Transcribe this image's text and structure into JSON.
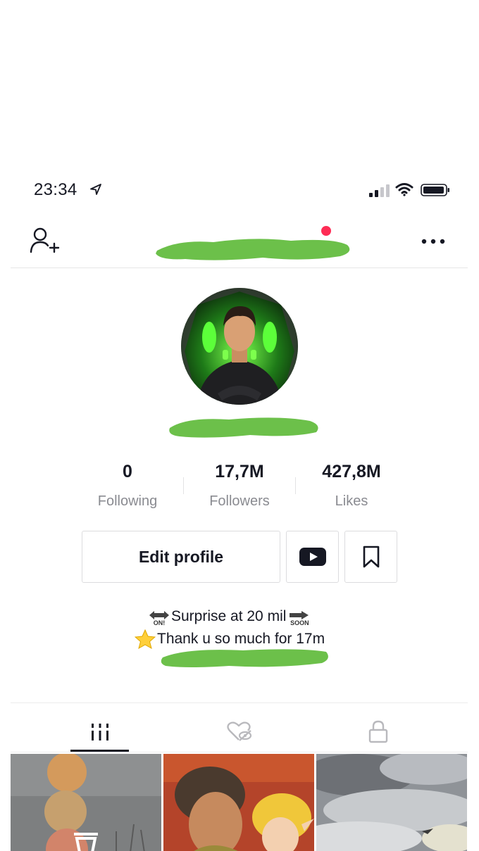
{
  "status_bar": {
    "time": "23:34",
    "location_icon": "location-arrow-icon",
    "signal_icon": "cellular-signal-icon",
    "wifi_icon": "wifi-icon",
    "battery_icon": "battery-icon"
  },
  "header": {
    "add_user_icon": "add-user-icon",
    "more_icon": "more-dots-icon",
    "notification_color": "#fe2c55"
  },
  "stats": [
    {
      "value": "0",
      "label": "Following"
    },
    {
      "value": "17,7M",
      "label": "Followers"
    },
    {
      "value": "427,8M",
      "label": "Likes"
    }
  ],
  "actions": {
    "edit_profile": "Edit profile",
    "youtube_icon": "youtube-icon",
    "bookmark_icon": "bookmark-icon"
  },
  "bio": {
    "line1": "Surprise at 20 mil",
    "on_tag": "ON!",
    "soon_tag": "SOON",
    "line2": "Thank u so much for 17m",
    "star_icon": "star-emoji-icon"
  },
  "tabs": [
    {
      "icon": "videos-grid-icon",
      "active": true
    },
    {
      "icon": "liked-hidden-icon",
      "active": false
    },
    {
      "icon": "lock-icon",
      "active": false
    }
  ],
  "colors": {
    "scribble_green": "#6cc04a",
    "accent_red": "#fe2c55",
    "muted_text": "#8a8b91"
  }
}
